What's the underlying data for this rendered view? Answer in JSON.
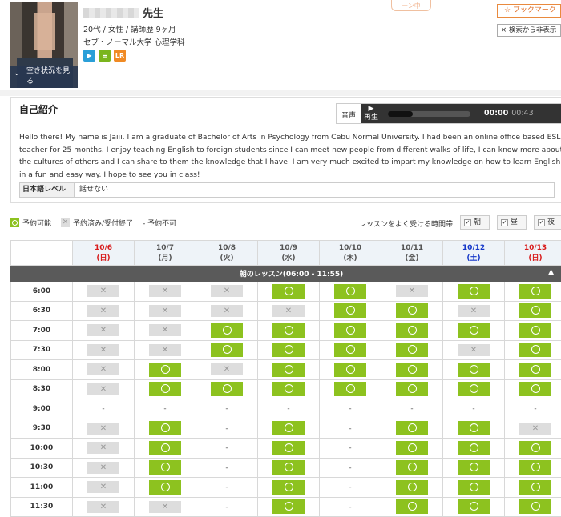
{
  "header": {
    "name_suffix": "先生",
    "meta1": "20代 / 女性 / 講師歴  9ヶ月",
    "meta2": "セブ・ノーマル大学  心理学科",
    "availability_label": "空き状況を見る",
    "top_button": "ーン中",
    "bookmark_label": "☆  ブックマーク",
    "hide_label": "× 検索から非表示",
    "icons": [
      {
        "name": "video-icon",
        "color": "#2a9fd8",
        "glyph": "▶"
      },
      {
        "name": "text-icon",
        "color": "#7ab51d",
        "glyph": "≡"
      },
      {
        "name": "lr-icon",
        "color": "#f08a24",
        "glyph": "LR"
      }
    ]
  },
  "intro": {
    "title": "自己紹介",
    "audio_label": "音声",
    "play_label": "▶\n再生",
    "time_current": "00:00",
    "time_total": "00:43",
    "audio_progress": 0.3,
    "text": "Hello there! My name is Jaiii. I am a graduate of Bachelor of Arts in Psychology from Cebu Normal University. I had been an online office based ESL teacher for 25 months. I enjoy teaching English to foreign students since I can meet new people from different walks of life, I can know more about the cultures of others and I can share to them the knowledge that I have. I am very much excited to impart my knowledge on how to learn English in a fun and easy way. I hope to see you in class!",
    "jp_level_key": "日本語レベル",
    "jp_level_value": "話せない"
  },
  "legend": {
    "available": "予約可能",
    "booked": "予約済み/受付終了",
    "unavailable": "- 予約不可"
  },
  "preferred": {
    "label": "レッスンをよく受ける時間帯",
    "options": [
      "朝",
      "昼",
      "夜"
    ]
  },
  "schedule": {
    "band_label": "朝のレッスン(06:00 - 11:55)",
    "band_arrow": "▲",
    "days": [
      {
        "date": "10/6",
        "dow": "(日)",
        "type": "sun"
      },
      {
        "date": "10/7",
        "dow": "(月)",
        "type": "norm"
      },
      {
        "date": "10/8",
        "dow": "(火)",
        "type": "norm"
      },
      {
        "date": "10/9",
        "dow": "(水)",
        "type": "norm"
      },
      {
        "date": "10/10",
        "dow": "(木)",
        "type": "norm"
      },
      {
        "date": "10/11",
        "dow": "(金)",
        "type": "norm"
      },
      {
        "date": "10/12",
        "dow": "(土)",
        "type": "sat"
      },
      {
        "date": "10/13",
        "dow": "(日)",
        "type": "sun"
      }
    ],
    "rows": [
      {
        "time": "6:00",
        "slots": [
          "x",
          "x",
          "x",
          "o",
          "o",
          "x",
          "o",
          "o"
        ]
      },
      {
        "time": "6:30",
        "slots": [
          "x",
          "x",
          "x",
          "x",
          "o",
          "o",
          "x",
          "o"
        ]
      },
      {
        "time": "7:00",
        "slots": [
          "x",
          "x",
          "o",
          "o",
          "o",
          "o",
          "o",
          "o"
        ]
      },
      {
        "time": "7:30",
        "slots": [
          "x",
          "x",
          "o",
          "o",
          "o",
          "o",
          "x",
          "o"
        ]
      },
      {
        "time": "8:00",
        "slots": [
          "x",
          "o",
          "x",
          "o",
          "o",
          "o",
          "o",
          "o"
        ]
      },
      {
        "time": "8:30",
        "slots": [
          "x",
          "o",
          "o",
          "o",
          "o",
          "o",
          "o",
          "o"
        ]
      },
      {
        "time": "9:00",
        "slots": [
          "-",
          "-",
          "-",
          "-",
          "-",
          "-",
          "-",
          "-"
        ]
      },
      {
        "time": "9:30",
        "slots": [
          "x",
          "o",
          "-",
          "o",
          "-",
          "o",
          "o",
          "x"
        ]
      },
      {
        "time": "10:00",
        "slots": [
          "x",
          "o",
          "-",
          "o",
          "-",
          "o",
          "o",
          "o"
        ]
      },
      {
        "time": "10:30",
        "slots": [
          "x",
          "o",
          "-",
          "o",
          "-",
          "o",
          "o",
          "o"
        ]
      },
      {
        "time": "11:00",
        "slots": [
          "x",
          "o",
          "-",
          "o",
          "-",
          "o",
          "o",
          "o"
        ]
      },
      {
        "time": "11:30",
        "slots": [
          "x",
          "x",
          "-",
          "o",
          "-",
          "o",
          "o",
          "o"
        ]
      }
    ]
  }
}
